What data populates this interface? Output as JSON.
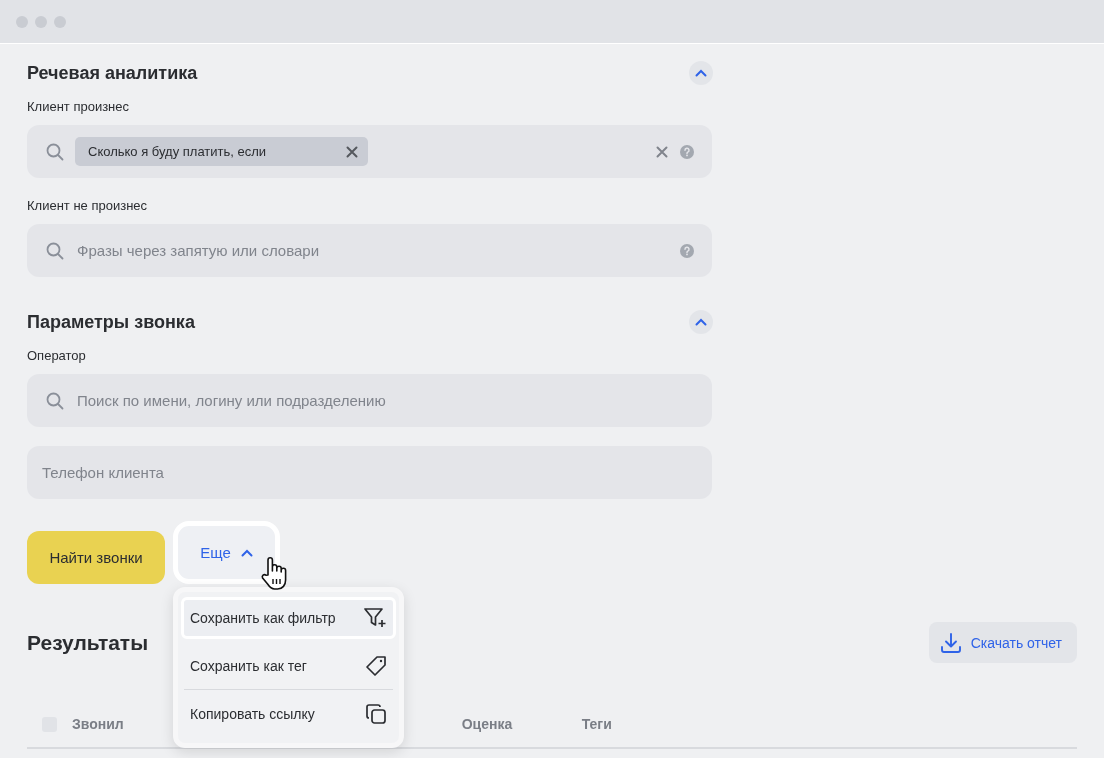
{
  "sections": [
    {
      "title": "Речевая аналитика",
      "expanded": true,
      "fields": [
        {
          "kind": "tags",
          "label": "Клиент произнес",
          "chips": [
            "Сколько я буду платить, если"
          ],
          "clearable": true,
          "help": true
        },
        {
          "kind": "search",
          "label": "Клиент не произнес",
          "placeholder": "Фразы через запятую или словари",
          "help": true
        }
      ]
    },
    {
      "title": "Параметры звонка",
      "expanded": true,
      "fields": [
        {
          "kind": "search",
          "label": "Оператор",
          "placeholder": "Поиск по имени, логину или подразделению",
          "help": false
        },
        {
          "kind": "text",
          "placeholder": "Телефон клиента"
        }
      ]
    }
  ],
  "actions": {
    "primary": "Найти звонки",
    "more": {
      "label": "Еще",
      "expanded": true
    }
  },
  "menu": [
    {
      "label": "Сохранить как фильтр",
      "kind": "filter-plus",
      "selected": true,
      "separated": false
    },
    {
      "label": "Сохранить как тег",
      "kind": "tag",
      "selected": false,
      "separated": false
    },
    {
      "label": "Копировать ссылку",
      "kind": "copy",
      "selected": false,
      "separated": true
    }
  ],
  "results": {
    "title": "Результаты",
    "download": "Скачать отчет",
    "select_all": {
      "checked": false
    },
    "columns": [
      {
        "label": "Звонил",
        "kind": "left"
      },
      {
        "label": "Оценка",
        "kind": "score"
      },
      {
        "label": "Теги",
        "kind": "tags"
      }
    ]
  }
}
